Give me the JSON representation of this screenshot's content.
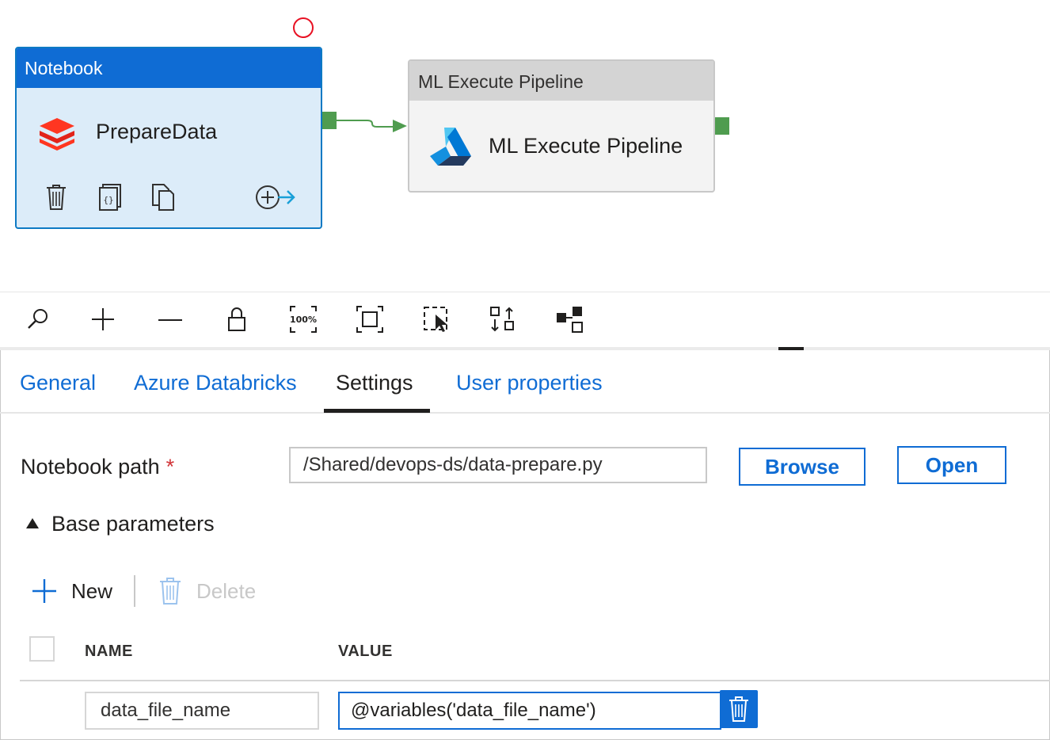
{
  "canvas": {
    "notebook_activity": {
      "type_label": "Notebook",
      "name": "PrepareData",
      "icons": [
        "delete-icon",
        "code-icon",
        "copy-icon",
        "add-output-icon"
      ]
    },
    "ml_activity": {
      "type_label": "ML Execute Pipeline",
      "name": "ML Execute Pipeline",
      "icon": "azure-ml-icon"
    }
  },
  "toolbar": {
    "tools": [
      "search-icon",
      "zoom-in-icon",
      "zoom-out-icon",
      "lock-icon",
      "zoom-100-icon",
      "fit-to-screen-icon",
      "select-icon",
      "auto-align-icon",
      "layout-icon"
    ],
    "zoom_text": "100%"
  },
  "tabs": [
    {
      "label": "General",
      "active": false
    },
    {
      "label": "Azure Databricks",
      "active": false
    },
    {
      "label": "Settings",
      "active": true
    },
    {
      "label": "User properties",
      "active": false
    }
  ],
  "settings": {
    "notebook_path_label": "Notebook path",
    "required_mark": "*",
    "notebook_path_value": "/Shared/devops-ds/data-prepare.py",
    "browse_label": "Browse",
    "open_label": "Open",
    "base_parameters_label": "Base parameters",
    "new_label": "New",
    "delete_label": "Delete",
    "columns": {
      "name": "NAME",
      "value": "VALUE"
    },
    "parameters": [
      {
        "name": "data_file_name",
        "value": "@variables('data_file_name')"
      }
    ]
  },
  "colors": {
    "accent": "#0f6cd4",
    "notebook_header": "#0f6cd4",
    "notebook_body": "#dcecf9",
    "success_port": "#4f9c4f",
    "error_circle": "#e81123"
  }
}
